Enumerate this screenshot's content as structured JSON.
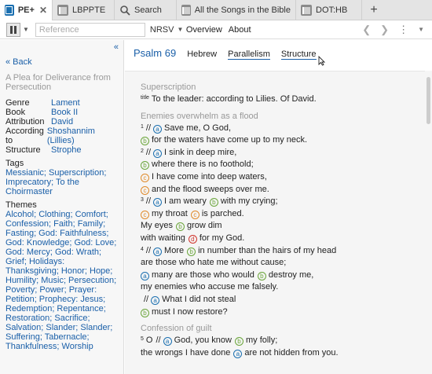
{
  "tabs": [
    {
      "label": "PE+",
      "icon": "passage-guide-icon",
      "active": true
    },
    {
      "label": "LBPPTE",
      "icon": "book-icon"
    },
    {
      "label": "Search",
      "icon": "search-icon"
    },
    {
      "label": "All the Songs in the Bible",
      "icon": "book-icon"
    },
    {
      "label": "DOT:HB",
      "icon": "book-icon"
    }
  ],
  "toolbar": {
    "reference_placeholder": "Reference",
    "version": "NRSV",
    "overview": "Overview",
    "about": "About"
  },
  "left": {
    "collapse": "«",
    "back": "« Back",
    "heading": "A Plea for Deliverance from Persecution",
    "props": [
      {
        "k": "Genre",
        "v": "Lament"
      },
      {
        "k": "Book",
        "v": "Book II"
      },
      {
        "k": "Attribution",
        "v": "David"
      },
      {
        "k": "According to",
        "v": "Shoshannim (Lillies)"
      },
      {
        "k": "Structure",
        "v": "Strophe"
      }
    ],
    "tags_label": "Tags",
    "tags": "Messianic; Superscription; Imprecatory; To the Choirmaster",
    "themes_label": "Themes",
    "themes": "Alcohol; Clothing; Comfort; Confession; Faith; Family; Fasting; God: Faithfulness; God: Knowledge; God: Love; God: Mercy; God: Wrath; Grief; Holidays: Thanksgiving; Honor; Hope; Humility; Music; Persecution; Poverty; Power; Prayer: Petition; Prophecy: Jesus; Redemption; Repentance; Restoration; Sacrifice; Salvation; Slander; Slander; Suffering; Tabernacle; Thankfulness; Worship"
  },
  "main": {
    "title": "Psalm 69",
    "tabs": [
      "Hebrew",
      "Parallelism",
      "Structure"
    ],
    "superscription_title": "Superscription",
    "superscription_mark": "title",
    "superscription_text": "To the leader: according to Lilies. Of David.",
    "section1": "Enemies overwhelm as a flood",
    "v1": "1",
    "v1a": "Save me, O God,",
    "v1b": "for the waters have come up to my neck.",
    "v2": "2",
    "v2a": "I sink in deep mire,",
    "v2b": "where there is no foothold;",
    "v2c": "I have come into deep waters,",
    "v2d": "and the flood sweeps over me.",
    "v3": "3",
    "v3a1": "I am weary",
    "v3a2": "with my crying;",
    "v3b1": "my throat",
    "v3b2": "is parched.",
    "v3c1": "My eyes",
    "v3c2": "grow dim",
    "v3d1": "with waiting",
    "v3d2": "for my God.",
    "v4": "4",
    "v4a1": "More",
    "v4a2": "in number than the hairs of my head",
    "v4b": "are those who hate me without cause;",
    "v4c1": "many are those who would",
    "v4c2": "destroy me,",
    "v4d": "my enemies who accuse me falsely.",
    "v4e": "What I did not steal",
    "v4f": "must I now restore?",
    "section2": "Confession of guilt",
    "v5": "5",
    "v5a1": "O",
    "v5a2": "God, you know",
    "v5a3": "my folly;",
    "v5b1": "the wrongs I have done",
    "v5b2": "are not hidden from you."
  },
  "markers": {
    "a": "a",
    "b": "b",
    "c": "c",
    "d": "d",
    "slash": "//"
  },
  "colors": {
    "link": "#1a5fa8",
    "a": "#1a6fb0",
    "b": "#6aa53a",
    "c": "#e08a2a",
    "d": "#d0342c"
  }
}
